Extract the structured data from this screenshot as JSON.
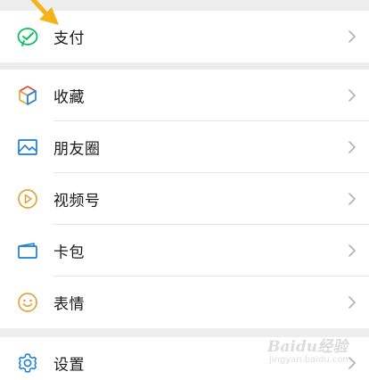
{
  "menu": {
    "pay": {
      "label": "支付",
      "icon": "wechat-pay-icon"
    },
    "group2": [
      {
        "label": "收藏",
        "icon": "favorites-cube-icon"
      },
      {
        "label": "朋友圈",
        "icon": "moments-picture-icon"
      },
      {
        "label": "视频号",
        "icon": "channels-play-icon"
      },
      {
        "label": "卡包",
        "icon": "card-wallet-icon"
      },
      {
        "label": "表情",
        "icon": "sticker-smile-icon"
      }
    ],
    "settings": {
      "label": "设置",
      "icon": "gear-icon"
    }
  },
  "watermark": {
    "logo": "Baidu经验",
    "url": "jingyan.baidu.com"
  },
  "colors": {
    "background": "#ededed",
    "row": "#ffffff",
    "green": "#07c160",
    "blue": "#1a7fd6",
    "gold": "#e0a53a",
    "arrow": "#f5b21a",
    "chevron": "#b2b2b2"
  }
}
